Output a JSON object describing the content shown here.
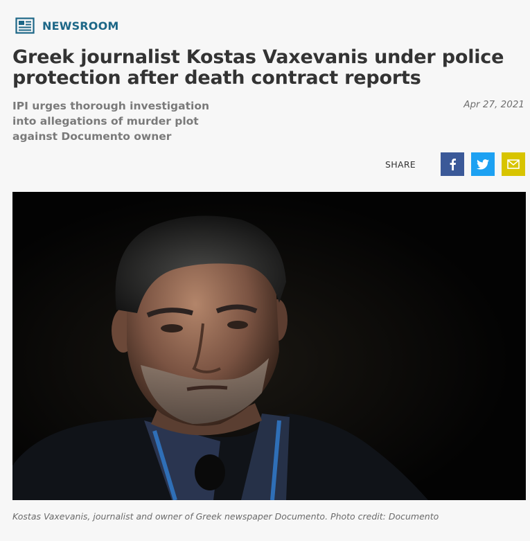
{
  "section": {
    "label": "NEWSROOM",
    "icon": "newspaper-icon"
  },
  "article": {
    "title": "Greek journalist Kostas Vaxevanis under police protection after death contract reports",
    "subtitle": "IPI urges thorough investigation into allegations of murder plot against Documento owner",
    "date": "Apr 27, 2021"
  },
  "share": {
    "label": "SHARE",
    "buttons": [
      {
        "name": "facebook",
        "icon": "facebook-icon",
        "color": "#3b5998"
      },
      {
        "name": "twitter",
        "icon": "twitter-icon",
        "color": "#1da1f2"
      },
      {
        "name": "email",
        "icon": "email-icon",
        "color": "#d8c400"
      }
    ]
  },
  "photo": {
    "caption": "Kostas Vaxevanis, journalist and owner of Greek newspaper Documento. Photo credit: Documento"
  },
  "colors": {
    "accent": "#1d6787",
    "title": "#333333",
    "background": "#f7f7f7"
  }
}
